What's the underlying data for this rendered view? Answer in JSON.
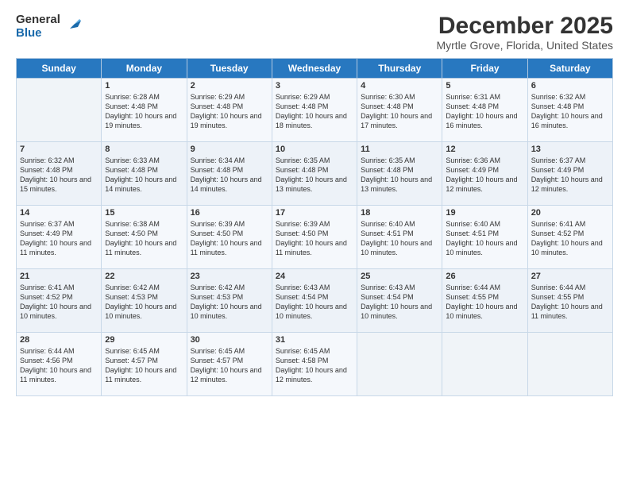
{
  "logo": {
    "line1": "General",
    "line2": "Blue"
  },
  "title": "December 2025",
  "subtitle": "Myrtle Grove, Florida, United States",
  "days_of_week": [
    "Sunday",
    "Monday",
    "Tuesday",
    "Wednesday",
    "Thursday",
    "Friday",
    "Saturday"
  ],
  "weeks": [
    [
      {
        "day": "",
        "sunrise": "",
        "sunset": "",
        "daylight": "",
        "empty": true
      },
      {
        "day": "1",
        "sunrise": "Sunrise: 6:28 AM",
        "sunset": "Sunset: 4:48 PM",
        "daylight": "Daylight: 10 hours and 19 minutes."
      },
      {
        "day": "2",
        "sunrise": "Sunrise: 6:29 AM",
        "sunset": "Sunset: 4:48 PM",
        "daylight": "Daylight: 10 hours and 19 minutes."
      },
      {
        "day": "3",
        "sunrise": "Sunrise: 6:29 AM",
        "sunset": "Sunset: 4:48 PM",
        "daylight": "Daylight: 10 hours and 18 minutes."
      },
      {
        "day": "4",
        "sunrise": "Sunrise: 6:30 AM",
        "sunset": "Sunset: 4:48 PM",
        "daylight": "Daylight: 10 hours and 17 minutes."
      },
      {
        "day": "5",
        "sunrise": "Sunrise: 6:31 AM",
        "sunset": "Sunset: 4:48 PM",
        "daylight": "Daylight: 10 hours and 16 minutes."
      },
      {
        "day": "6",
        "sunrise": "Sunrise: 6:32 AM",
        "sunset": "Sunset: 4:48 PM",
        "daylight": "Daylight: 10 hours and 16 minutes."
      }
    ],
    [
      {
        "day": "7",
        "sunrise": "Sunrise: 6:32 AM",
        "sunset": "Sunset: 4:48 PM",
        "daylight": "Daylight: 10 hours and 15 minutes."
      },
      {
        "day": "8",
        "sunrise": "Sunrise: 6:33 AM",
        "sunset": "Sunset: 4:48 PM",
        "daylight": "Daylight: 10 hours and 14 minutes."
      },
      {
        "day": "9",
        "sunrise": "Sunrise: 6:34 AM",
        "sunset": "Sunset: 4:48 PM",
        "daylight": "Daylight: 10 hours and 14 minutes."
      },
      {
        "day": "10",
        "sunrise": "Sunrise: 6:35 AM",
        "sunset": "Sunset: 4:48 PM",
        "daylight": "Daylight: 10 hours and 13 minutes."
      },
      {
        "day": "11",
        "sunrise": "Sunrise: 6:35 AM",
        "sunset": "Sunset: 4:48 PM",
        "daylight": "Daylight: 10 hours and 13 minutes."
      },
      {
        "day": "12",
        "sunrise": "Sunrise: 6:36 AM",
        "sunset": "Sunset: 4:49 PM",
        "daylight": "Daylight: 10 hours and 12 minutes."
      },
      {
        "day": "13",
        "sunrise": "Sunrise: 6:37 AM",
        "sunset": "Sunset: 4:49 PM",
        "daylight": "Daylight: 10 hours and 12 minutes."
      }
    ],
    [
      {
        "day": "14",
        "sunrise": "Sunrise: 6:37 AM",
        "sunset": "Sunset: 4:49 PM",
        "daylight": "Daylight: 10 hours and 11 minutes."
      },
      {
        "day": "15",
        "sunrise": "Sunrise: 6:38 AM",
        "sunset": "Sunset: 4:50 PM",
        "daylight": "Daylight: 10 hours and 11 minutes."
      },
      {
        "day": "16",
        "sunrise": "Sunrise: 6:39 AM",
        "sunset": "Sunset: 4:50 PM",
        "daylight": "Daylight: 10 hours and 11 minutes."
      },
      {
        "day": "17",
        "sunrise": "Sunrise: 6:39 AM",
        "sunset": "Sunset: 4:50 PM",
        "daylight": "Daylight: 10 hours and 11 minutes."
      },
      {
        "day": "18",
        "sunrise": "Sunrise: 6:40 AM",
        "sunset": "Sunset: 4:51 PM",
        "daylight": "Daylight: 10 hours and 10 minutes."
      },
      {
        "day": "19",
        "sunrise": "Sunrise: 6:40 AM",
        "sunset": "Sunset: 4:51 PM",
        "daylight": "Daylight: 10 hours and 10 minutes."
      },
      {
        "day": "20",
        "sunrise": "Sunrise: 6:41 AM",
        "sunset": "Sunset: 4:52 PM",
        "daylight": "Daylight: 10 hours and 10 minutes."
      }
    ],
    [
      {
        "day": "21",
        "sunrise": "Sunrise: 6:41 AM",
        "sunset": "Sunset: 4:52 PM",
        "daylight": "Daylight: 10 hours and 10 minutes."
      },
      {
        "day": "22",
        "sunrise": "Sunrise: 6:42 AM",
        "sunset": "Sunset: 4:53 PM",
        "daylight": "Daylight: 10 hours and 10 minutes."
      },
      {
        "day": "23",
        "sunrise": "Sunrise: 6:42 AM",
        "sunset": "Sunset: 4:53 PM",
        "daylight": "Daylight: 10 hours and 10 minutes."
      },
      {
        "day": "24",
        "sunrise": "Sunrise: 6:43 AM",
        "sunset": "Sunset: 4:54 PM",
        "daylight": "Daylight: 10 hours and 10 minutes."
      },
      {
        "day": "25",
        "sunrise": "Sunrise: 6:43 AM",
        "sunset": "Sunset: 4:54 PM",
        "daylight": "Daylight: 10 hours and 10 minutes."
      },
      {
        "day": "26",
        "sunrise": "Sunrise: 6:44 AM",
        "sunset": "Sunset: 4:55 PM",
        "daylight": "Daylight: 10 hours and 10 minutes."
      },
      {
        "day": "27",
        "sunrise": "Sunrise: 6:44 AM",
        "sunset": "Sunset: 4:55 PM",
        "daylight": "Daylight: 10 hours and 11 minutes."
      }
    ],
    [
      {
        "day": "28",
        "sunrise": "Sunrise: 6:44 AM",
        "sunset": "Sunset: 4:56 PM",
        "daylight": "Daylight: 10 hours and 11 minutes."
      },
      {
        "day": "29",
        "sunrise": "Sunrise: 6:45 AM",
        "sunset": "Sunset: 4:57 PM",
        "daylight": "Daylight: 10 hours and 11 minutes."
      },
      {
        "day": "30",
        "sunrise": "Sunrise: 6:45 AM",
        "sunset": "Sunset: 4:57 PM",
        "daylight": "Daylight: 10 hours and 12 minutes."
      },
      {
        "day": "31",
        "sunrise": "Sunrise: 6:45 AM",
        "sunset": "Sunset: 4:58 PM",
        "daylight": "Daylight: 10 hours and 12 minutes."
      },
      {
        "day": "",
        "sunrise": "",
        "sunset": "",
        "daylight": "",
        "empty": true
      },
      {
        "day": "",
        "sunrise": "",
        "sunset": "",
        "daylight": "",
        "empty": true
      },
      {
        "day": "",
        "sunrise": "",
        "sunset": "",
        "daylight": "",
        "empty": true
      }
    ]
  ]
}
